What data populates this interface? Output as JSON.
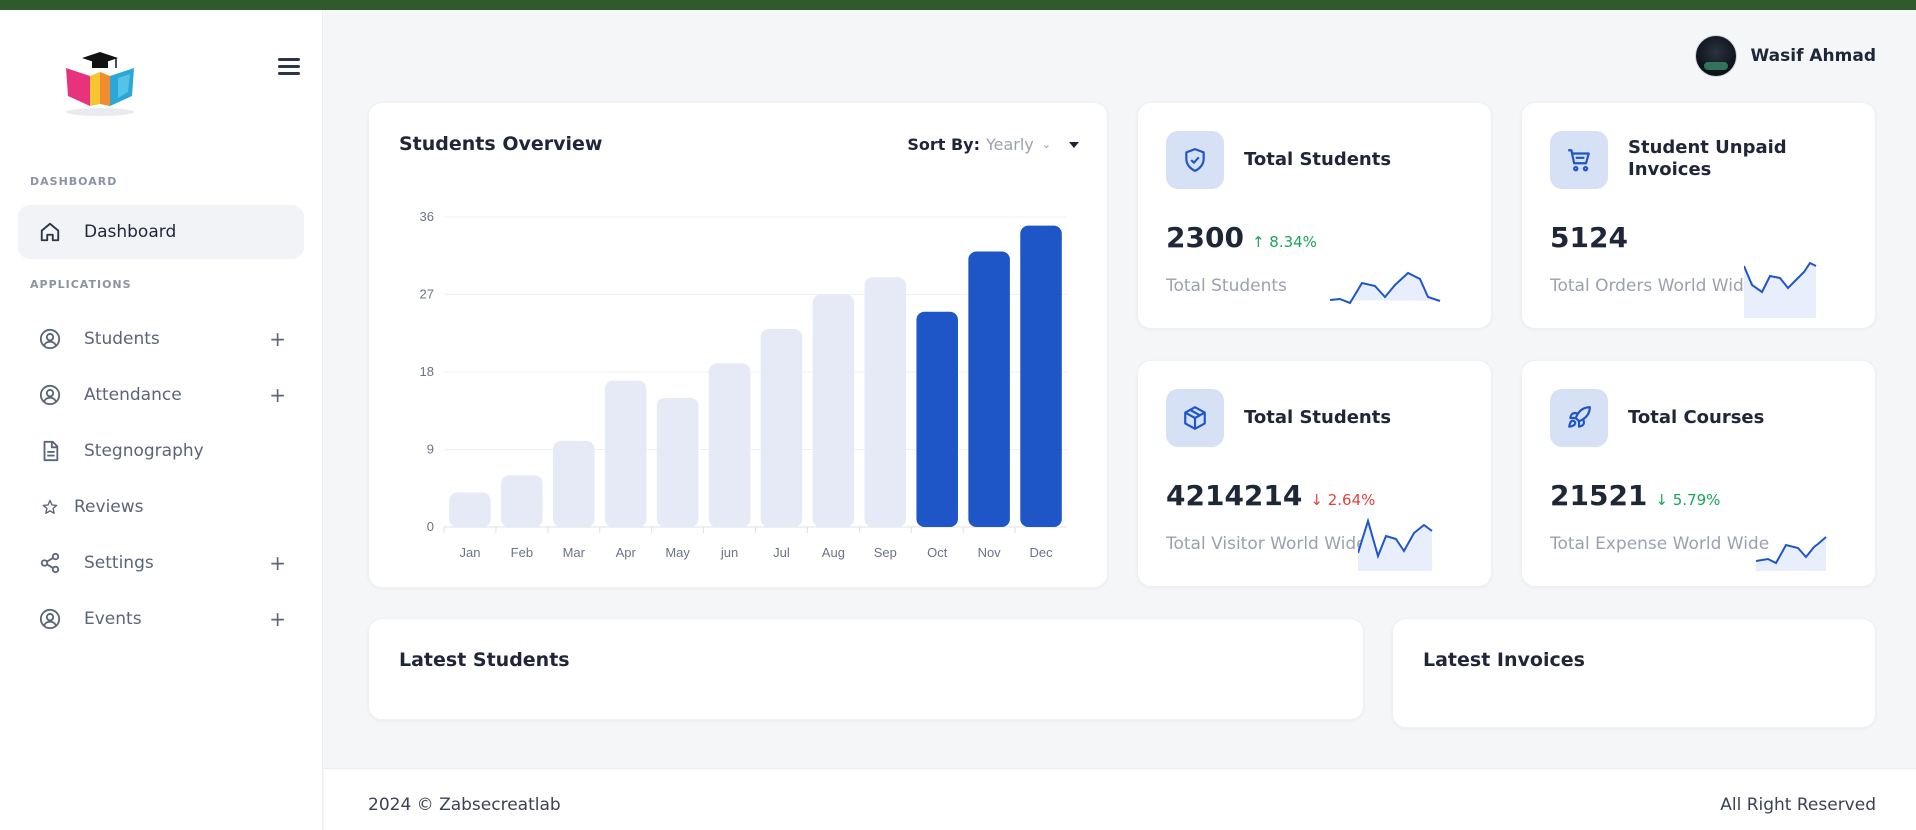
{
  "app": {
    "colors": {
      "topbar": "#2f5a2c",
      "accent": "#1e56c7",
      "light_bar": "#e6eaf7"
    }
  },
  "sidebar": {
    "logo": "book-logo-icon",
    "sections": {
      "dashboard": "DASHBOARD",
      "applications": "APPLICATIONS"
    },
    "items": [
      {
        "label": "Dashboard",
        "icon": "home-icon",
        "plus": ""
      },
      {
        "label": "Students",
        "icon": "user-circle-icon",
        "plus": "+"
      },
      {
        "label": "Attendance",
        "icon": "user-circle-icon",
        "plus": "+"
      },
      {
        "label": "Stegnography",
        "icon": "document-icon",
        "plus": ""
      },
      {
        "label": "Reviews",
        "icon": "star-icon",
        "plus": ""
      },
      {
        "label": "Settings",
        "icon": "share-icon",
        "plus": "+"
      },
      {
        "label": "Events",
        "icon": "user-circle-icon",
        "plus": "+"
      }
    ]
  },
  "header": {
    "user_name": "Wasif Ahmad"
  },
  "overview": {
    "title": "Students Overview",
    "sort_label": "Sort By:",
    "sort_value": "Yearly"
  },
  "chart_data": {
    "type": "bar",
    "title": "Students Overview",
    "categories": [
      "Jan",
      "Feb",
      "Mar",
      "Apr",
      "May",
      "jun",
      "Jul",
      "Aug",
      "Sep",
      "Oct",
      "Nov",
      "Dec"
    ],
    "values": [
      4,
      6,
      10,
      17,
      15,
      19,
      23,
      27,
      29,
      25,
      32,
      35
    ],
    "highlighted": [
      false,
      false,
      false,
      false,
      false,
      false,
      false,
      false,
      false,
      true,
      true,
      true
    ],
    "yticks": [
      "0",
      "9",
      "18",
      "27",
      "36"
    ],
    "ylim": [
      0,
      36
    ],
    "grid": true
  },
  "stats": [
    {
      "title": "Total Students",
      "value": "2300",
      "delta": "8.34%",
      "direction": "up",
      "sub": "Total Students",
      "icon": "shield-check-icon"
    },
    {
      "title": "Student Unpaid Invoices",
      "value": "5124",
      "delta": "",
      "direction": "",
      "sub": "Total Orders World Wide",
      "icon": "cart-icon"
    },
    {
      "title": "Total Students",
      "value": "4214214",
      "delta": "2.64%",
      "direction": "down",
      "sub": "Total Visitor World Wide",
      "icon": "box-icon"
    },
    {
      "title": "Total Courses",
      "value": "21521",
      "delta": "5.79%",
      "direction": "down-green",
      "sub": "Total Expense World Wide",
      "icon": "rocket-icon"
    }
  ],
  "latest": {
    "students": "Latest Students",
    "invoices": "Latest Invoices"
  },
  "footer": {
    "copyright": "2024 © Zabsecreatlab",
    "rights": "All Right Reserved"
  }
}
